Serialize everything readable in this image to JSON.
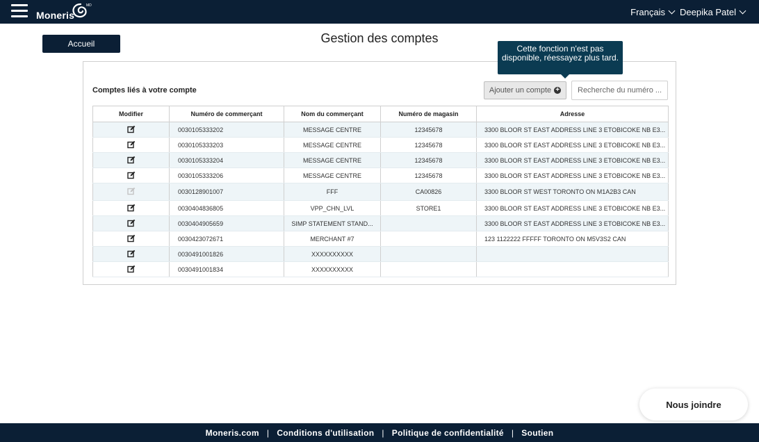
{
  "header": {
    "brand": "Moneris",
    "language": "Français",
    "user": "Deepika Patel"
  },
  "accueil_label": "Accueil",
  "page_title": "Gestion des comptes",
  "tooltip": "Cette fonction n'est pas disponible, réessayez plus tard.",
  "panel": {
    "label": "Comptes liés à votre compte",
    "add_button": "Ajouter un compte",
    "search_placeholder": "Recherche du numéro ..."
  },
  "table": {
    "columns": [
      "Modifier",
      "Numéro de commerçant",
      "Nom du commerçant",
      "Numéro de magasin",
      "Adresse"
    ],
    "rows": [
      {
        "number": "0030105333202",
        "name": "MESSAGE CENTRE",
        "store": "12345678",
        "address": "3300 BLOOR ST EAST ADDRESS LINE 3 ETOBICOKE NB E3...",
        "editable": true
      },
      {
        "number": "0030105333203",
        "name": "MESSAGE CENTRE",
        "store": "12345678",
        "address": "3300 BLOOR ST EAST ADDRESS LINE 3 ETOBICOKE NB E3...",
        "editable": true
      },
      {
        "number": "0030105333204",
        "name": "MESSAGE CENTRE",
        "store": "12345678",
        "address": "3300 BLOOR ST EAST ADDRESS LINE 3 ETOBICOKE NB E3...",
        "editable": true
      },
      {
        "number": "0030105333206",
        "name": "MESSAGE CENTRE",
        "store": "12345678",
        "address": "3300 BLOOR ST EAST ADDRESS LINE 3 ETOBICOKE NB E3...",
        "editable": true
      },
      {
        "number": "0030128901007",
        "name": "FFF",
        "store": "CA00826",
        "address": "3300 BLOOR ST WEST TORONTO ON M1A2B3 CAN",
        "editable": false
      },
      {
        "number": "0030404836805",
        "name": "VPP_CHN_LVL",
        "store": "STORE1",
        "address": "3300 BLOOR ST EAST ADDRESS LINE 3 ETOBICOKE NB E3...",
        "editable": true
      },
      {
        "number": "0030404905659",
        "name": "SIMP STATEMENT STAND...",
        "store": "",
        "address": "3300 BLOOR ST EAST ADDRESS LINE 3 ETOBICOKE NB E3...",
        "editable": true
      },
      {
        "number": "0030423072671",
        "name": "MERCHANT #7",
        "store": "",
        "address": "123 1122222 FFFFF TORONTO ON M5V3S2 CAN",
        "editable": true
      },
      {
        "number": "0030491001826",
        "name": "XXXXXXXXXX",
        "store": "",
        "address": "",
        "editable": true
      },
      {
        "number": "0030491001834",
        "name": "XXXXXXXXXX",
        "store": "",
        "address": "",
        "editable": true
      }
    ]
  },
  "chat_label": "Nous joindre",
  "footer": {
    "links": [
      "Moneris.com",
      "Conditions d'utilisation",
      "Politique de confidentialité",
      "Soutien"
    ]
  }
}
